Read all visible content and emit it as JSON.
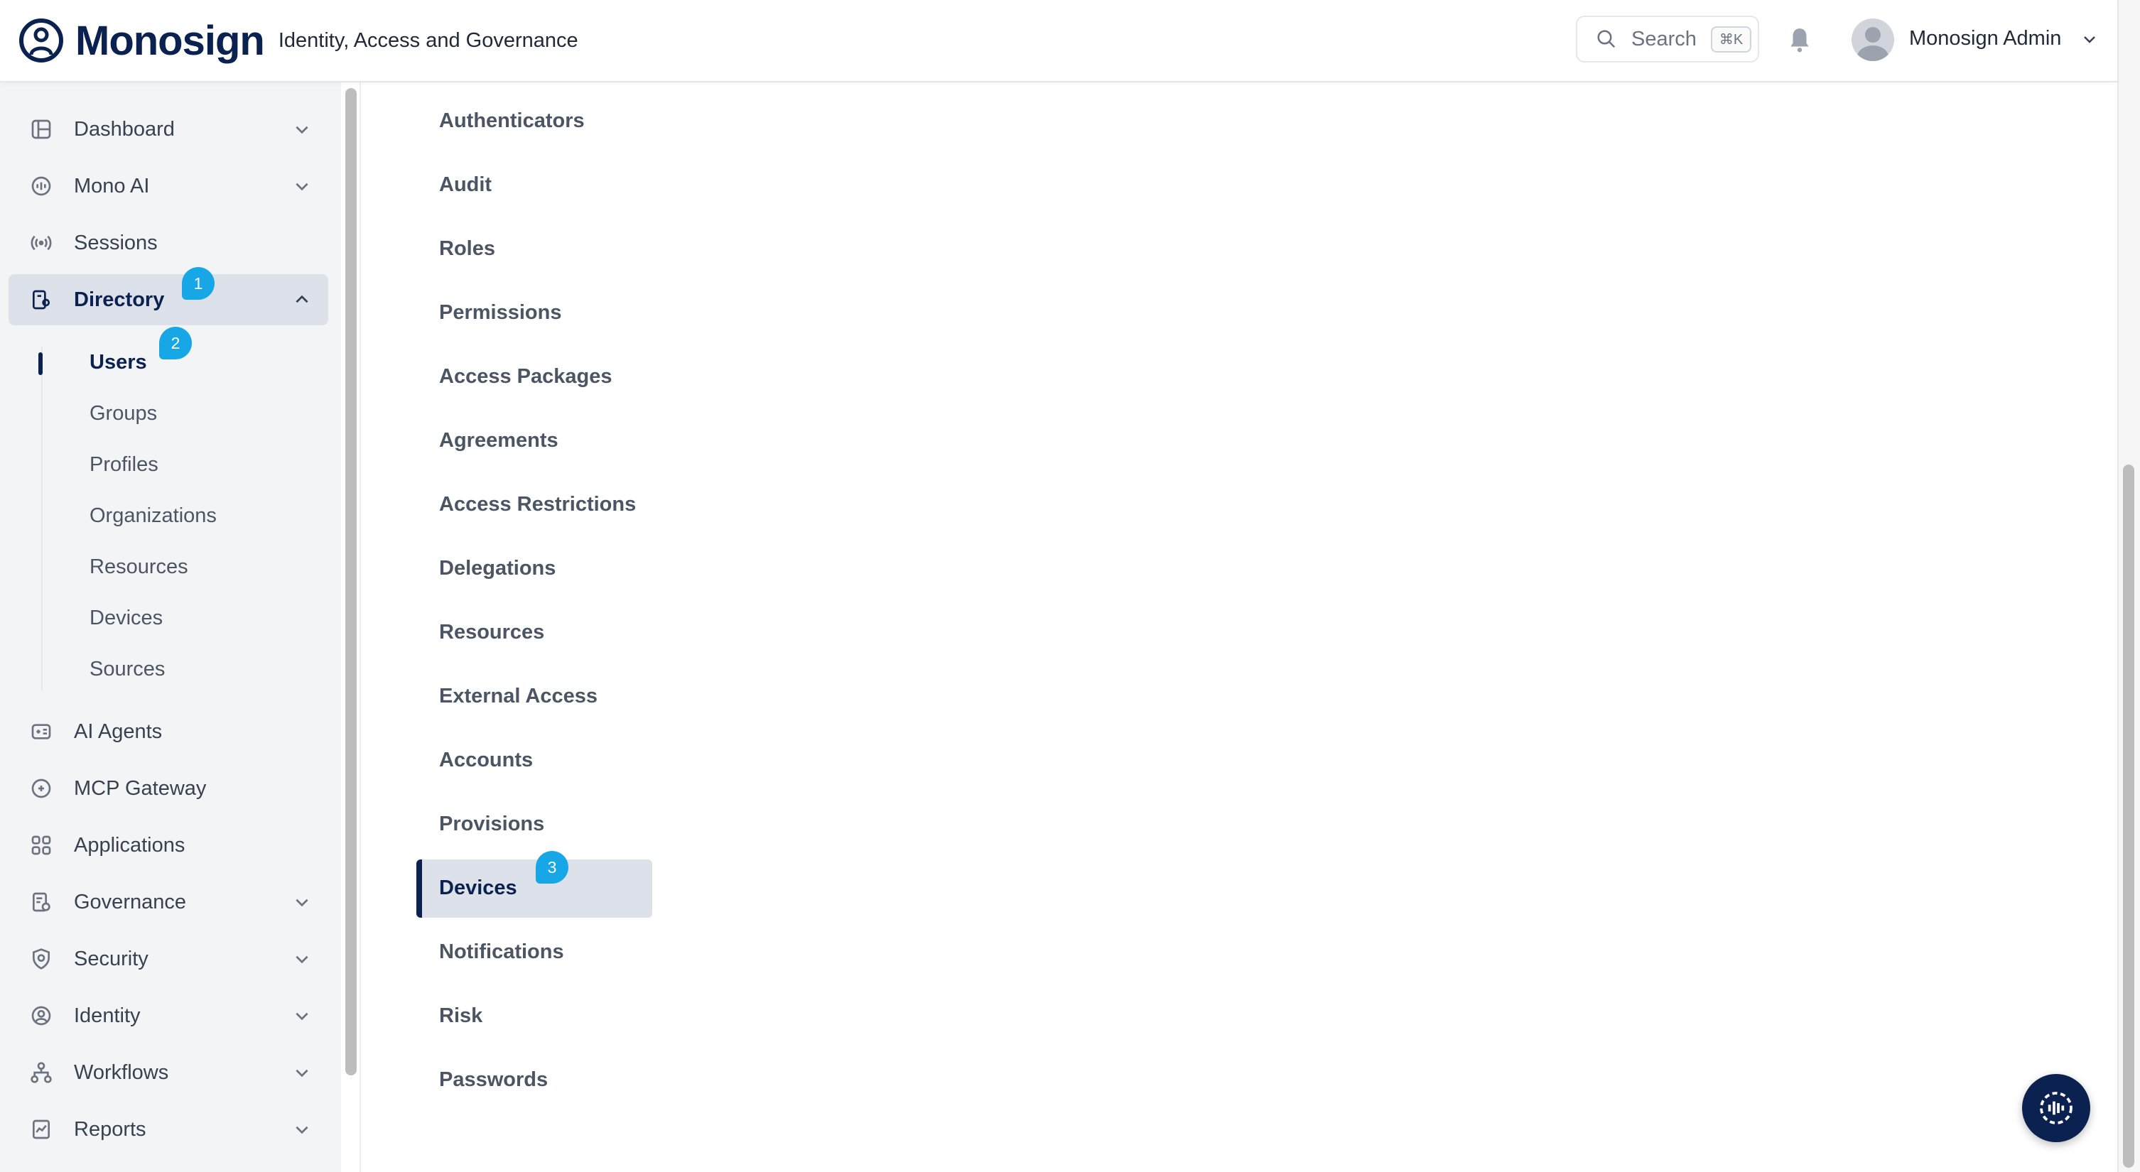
{
  "header": {
    "brand_name": "Monosign",
    "tagline": "Identity, Access and Governance",
    "search_label": "Search",
    "search_shortcut": "⌘K",
    "user_name": "Monosign Admin"
  },
  "sidebar": {
    "items": [
      {
        "label": "Dashboard"
      },
      {
        "label": "Mono AI"
      },
      {
        "label": "Sessions"
      },
      {
        "label": "Directory"
      },
      {
        "label": "AI Agents"
      },
      {
        "label": "MCP Gateway"
      },
      {
        "label": "Applications"
      },
      {
        "label": "Governance"
      },
      {
        "label": "Security"
      },
      {
        "label": "Identity"
      },
      {
        "label": "Workflows"
      },
      {
        "label": "Reports"
      }
    ],
    "directory_sub": [
      "Users",
      "Groups",
      "Profiles",
      "Organizations",
      "Resources",
      "Devices",
      "Sources"
    ]
  },
  "settings_menu": [
    "Authenticators",
    "Audit",
    "Roles",
    "Permissions",
    "Access Packages",
    "Agreements",
    "Access Restrictions",
    "Delegations",
    "Resources",
    "External Access",
    "Accounts",
    "Provisions",
    "Devices",
    "Notifications",
    "Risk",
    "Passwords"
  ],
  "markers": [
    "1",
    "2",
    "3"
  ],
  "colors": {
    "brand": "#0b2251",
    "marker": "#17a7e6",
    "active_bg": "#dde2ea"
  }
}
